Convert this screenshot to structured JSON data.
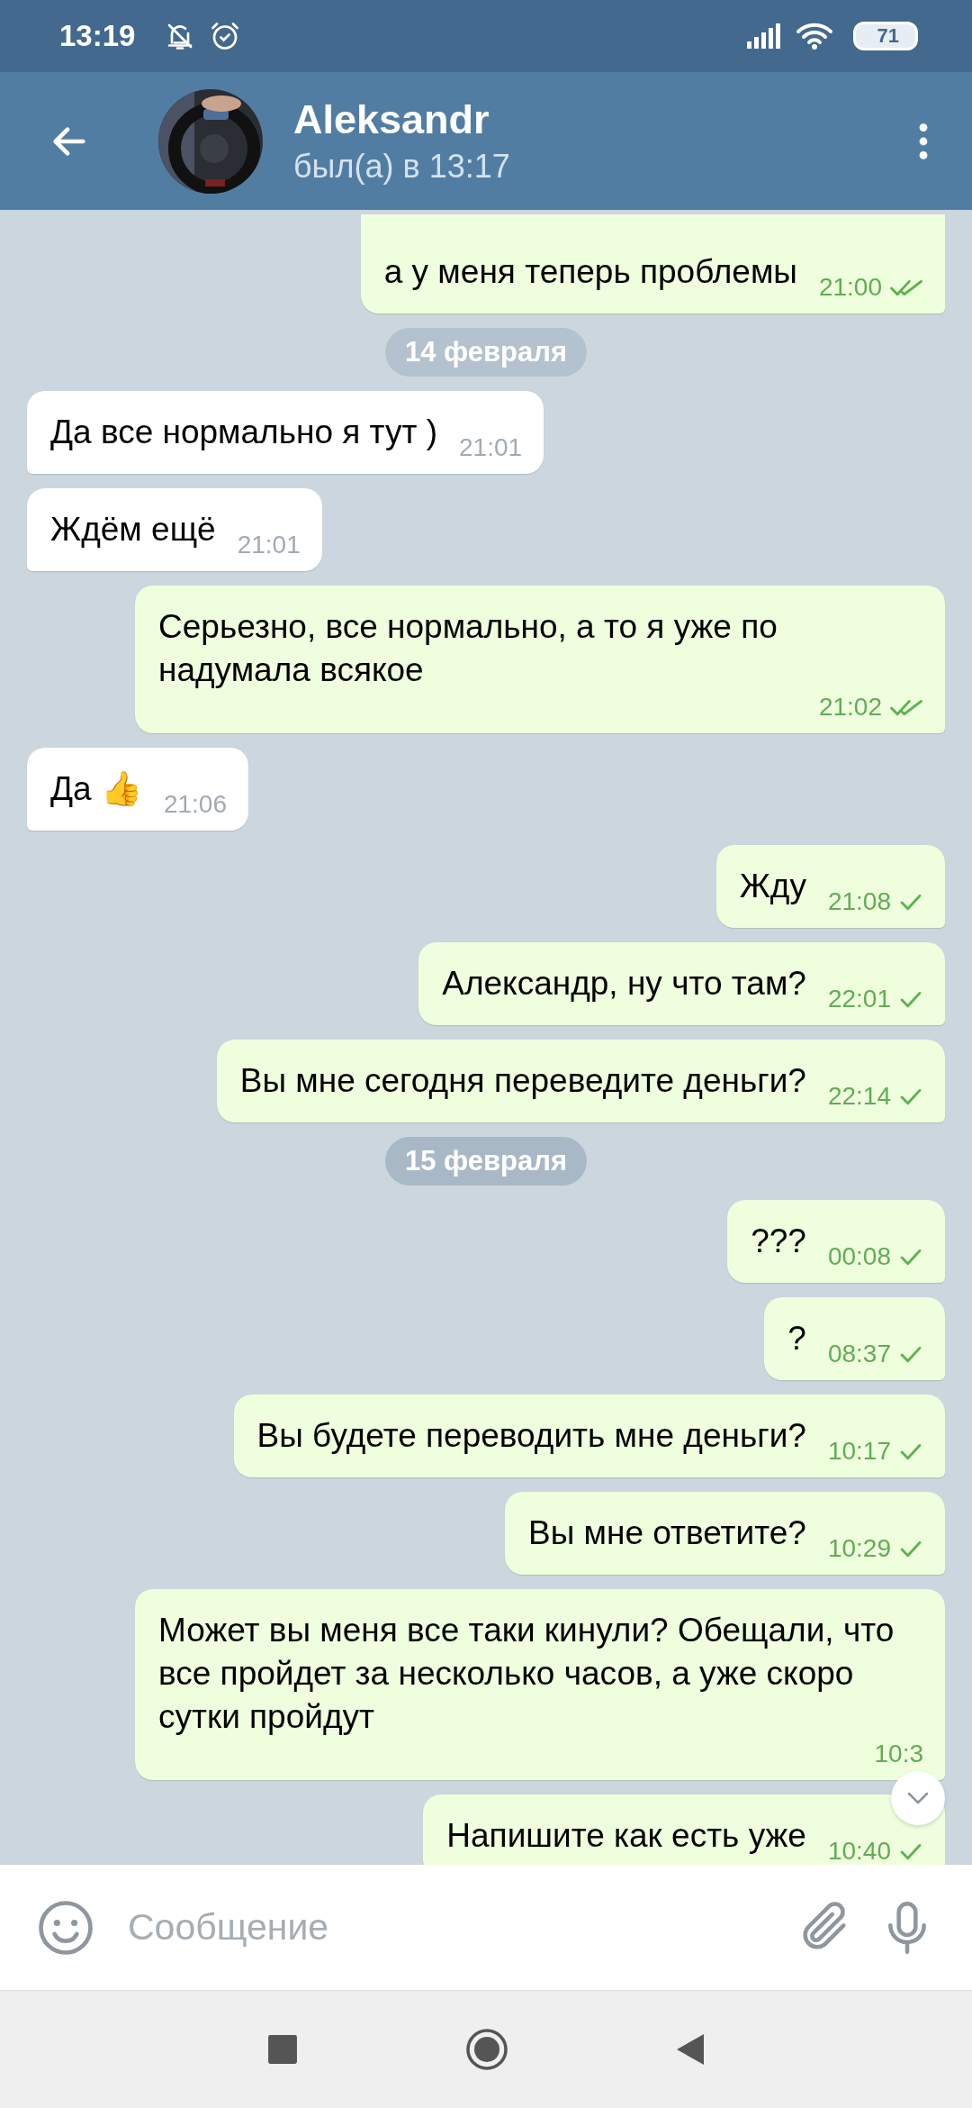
{
  "status_bar": {
    "time": "13:19",
    "battery": "71"
  },
  "header": {
    "name": "Aleksandr",
    "status": "был(а) в 13:17"
  },
  "messages": [
    {
      "kind": "out",
      "text": "а у меня теперь проблемы",
      "time": "21:00",
      "read": true
    },
    {
      "kind": "date",
      "text": "14 февраля",
      "floating": true
    },
    {
      "kind": "in",
      "text": "Да все нормально я тут )",
      "time": "21:01"
    },
    {
      "kind": "in",
      "text": "Ждём ещё",
      "time": "21:01"
    },
    {
      "kind": "out",
      "text": "Серьезно, все нормально, а то я уже по надумала всякое",
      "time": "21:02",
      "read": true
    },
    {
      "kind": "in",
      "text": "Да 👍",
      "time": "21:06"
    },
    {
      "kind": "out",
      "text": "Жду",
      "time": "21:08",
      "read": false
    },
    {
      "kind": "out",
      "text": "Александр, ну что там?",
      "time": "22:01",
      "read": false
    },
    {
      "kind": "out",
      "text": "Вы мне сегодня переведите деньги?",
      "time": "22:14",
      "read": false
    },
    {
      "kind": "date",
      "text": "15 февраля",
      "floating": false
    },
    {
      "kind": "out",
      "text": "???",
      "time": "00:08",
      "read": false
    },
    {
      "kind": "out",
      "text": "?",
      "time": "08:37",
      "read": false
    },
    {
      "kind": "out",
      "text": "Вы будете переводить мне деньги?",
      "time": "10:17",
      "read": false
    },
    {
      "kind": "out",
      "text": "Вы мне ответите?",
      "time": "10:29",
      "read": false
    },
    {
      "kind": "out",
      "text": "Может вы меня все таки кинули? Обещали, что все пройдет за несколько часов, а уже скоро сутки пройдут",
      "time": "10:3"
    },
    {
      "kind": "out",
      "text": "Напишите как есть уже",
      "time": "10:40",
      "read": false
    }
  ],
  "composer": {
    "placeholder": "Сообщение"
  }
}
